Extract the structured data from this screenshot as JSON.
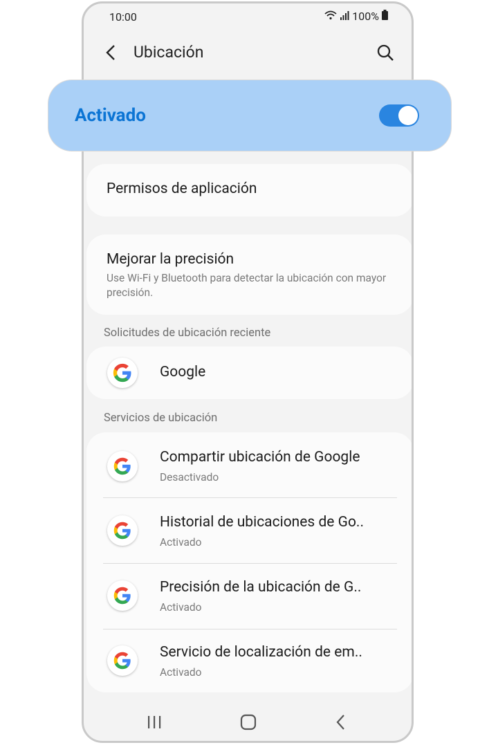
{
  "status": {
    "time": "10:00",
    "battery": "100%"
  },
  "header": {
    "title": "Ubicación"
  },
  "master_toggle": {
    "label": "Activado",
    "state": "on"
  },
  "permissions": {
    "label": "Permisos de aplicación"
  },
  "accuracy": {
    "title": "Mejorar la precisión",
    "subtitle": "Use Wi-Fi y Bluetooth para detectar la ubicación con mayor precisión."
  },
  "recent": {
    "section_label": "Solicitudes de ubicación reciente",
    "items": [
      {
        "label": "Google"
      }
    ]
  },
  "services": {
    "section_label": "Servicios de ubicación",
    "items": [
      {
        "title": "Compartir ubicación de Google",
        "status": "Desactivado"
      },
      {
        "title": "Historial de ubicaciones de Go..",
        "status": "Activado"
      },
      {
        "title": "Precisión de la ubicación de G..",
        "status": "Activado"
      },
      {
        "title": "Servicio de localización de em..",
        "status": "Activado"
      }
    ]
  },
  "colors": {
    "accent": "#0b74d4",
    "highlight": "#aad0f7",
    "toggle": "#2a85e0"
  }
}
